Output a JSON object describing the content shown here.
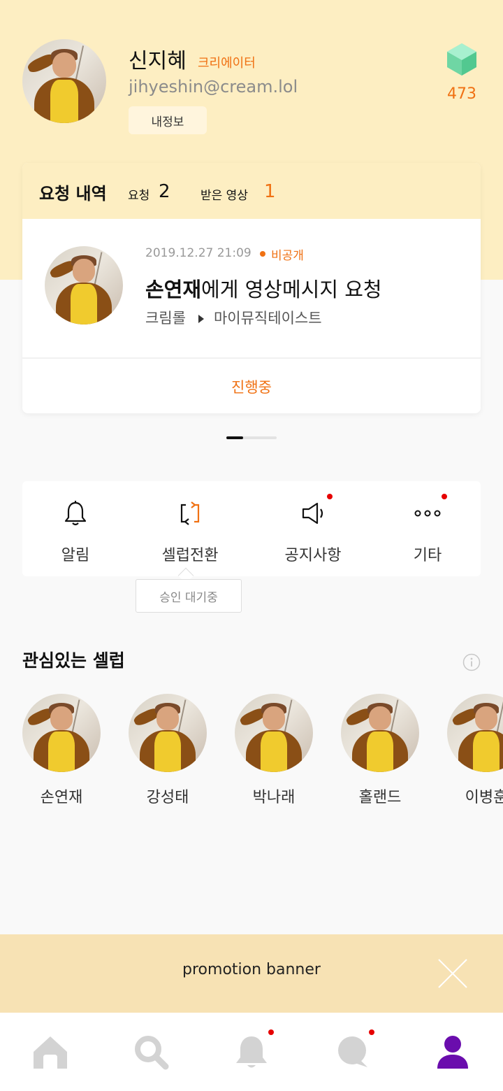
{
  "profile": {
    "name": "신지혜",
    "role": "크리에이터",
    "email": "jihyeshin@cream.lol",
    "my_info_label": "내정보",
    "gem_count": "473"
  },
  "request_card": {
    "title": "요청 내역",
    "request_label": "요청",
    "request_count": "2",
    "received_label": "받은 영상",
    "received_count": "1",
    "item": {
      "datetime": "2019.12.27 21:09",
      "visibility": "비공개",
      "celeb_name": "손연재",
      "message_rest": "에게 영상메시지 요청",
      "path_from": "크림롤",
      "path_to": "마이뮤직테이스트",
      "status": "진행중"
    },
    "pager": {
      "pages": 3,
      "active_index": 0
    }
  },
  "menu": {
    "items": [
      {
        "label": "알림",
        "icon": "bell-icon",
        "has_badge": false
      },
      {
        "label": "셀럽전환",
        "icon": "switch-icon",
        "has_badge": false
      },
      {
        "label": "공지사항",
        "icon": "megaphone-icon",
        "has_badge": true
      },
      {
        "label": "기타",
        "icon": "more-icon",
        "has_badge": true
      }
    ],
    "tooltip": "승인 대기중"
  },
  "celebs": {
    "title": "관심있는 셀럽",
    "items": [
      {
        "name": "손연재"
      },
      {
        "name": "강성태"
      },
      {
        "name": "박나래"
      },
      {
        "name": "홀랜드"
      },
      {
        "name": "이병훈"
      }
    ]
  },
  "banner": {
    "text": "promotion banner"
  },
  "bottom_nav": {
    "items": [
      {
        "icon": "home-icon",
        "active": false,
        "badge": false
      },
      {
        "icon": "search-icon",
        "active": false,
        "badge": false
      },
      {
        "icon": "notification-bell-icon",
        "active": false,
        "badge": true
      },
      {
        "icon": "chat-icon",
        "active": false,
        "badge": true
      },
      {
        "icon": "profile-icon",
        "active": true,
        "badge": false
      }
    ]
  },
  "colors": {
    "accent": "#f07113",
    "header_bg": "#fdeec2",
    "banner_bg": "#f7e2b4",
    "active_nav": "#6a0dad",
    "inactive_nav": "#d3d3d3",
    "badge": "#e60000"
  }
}
